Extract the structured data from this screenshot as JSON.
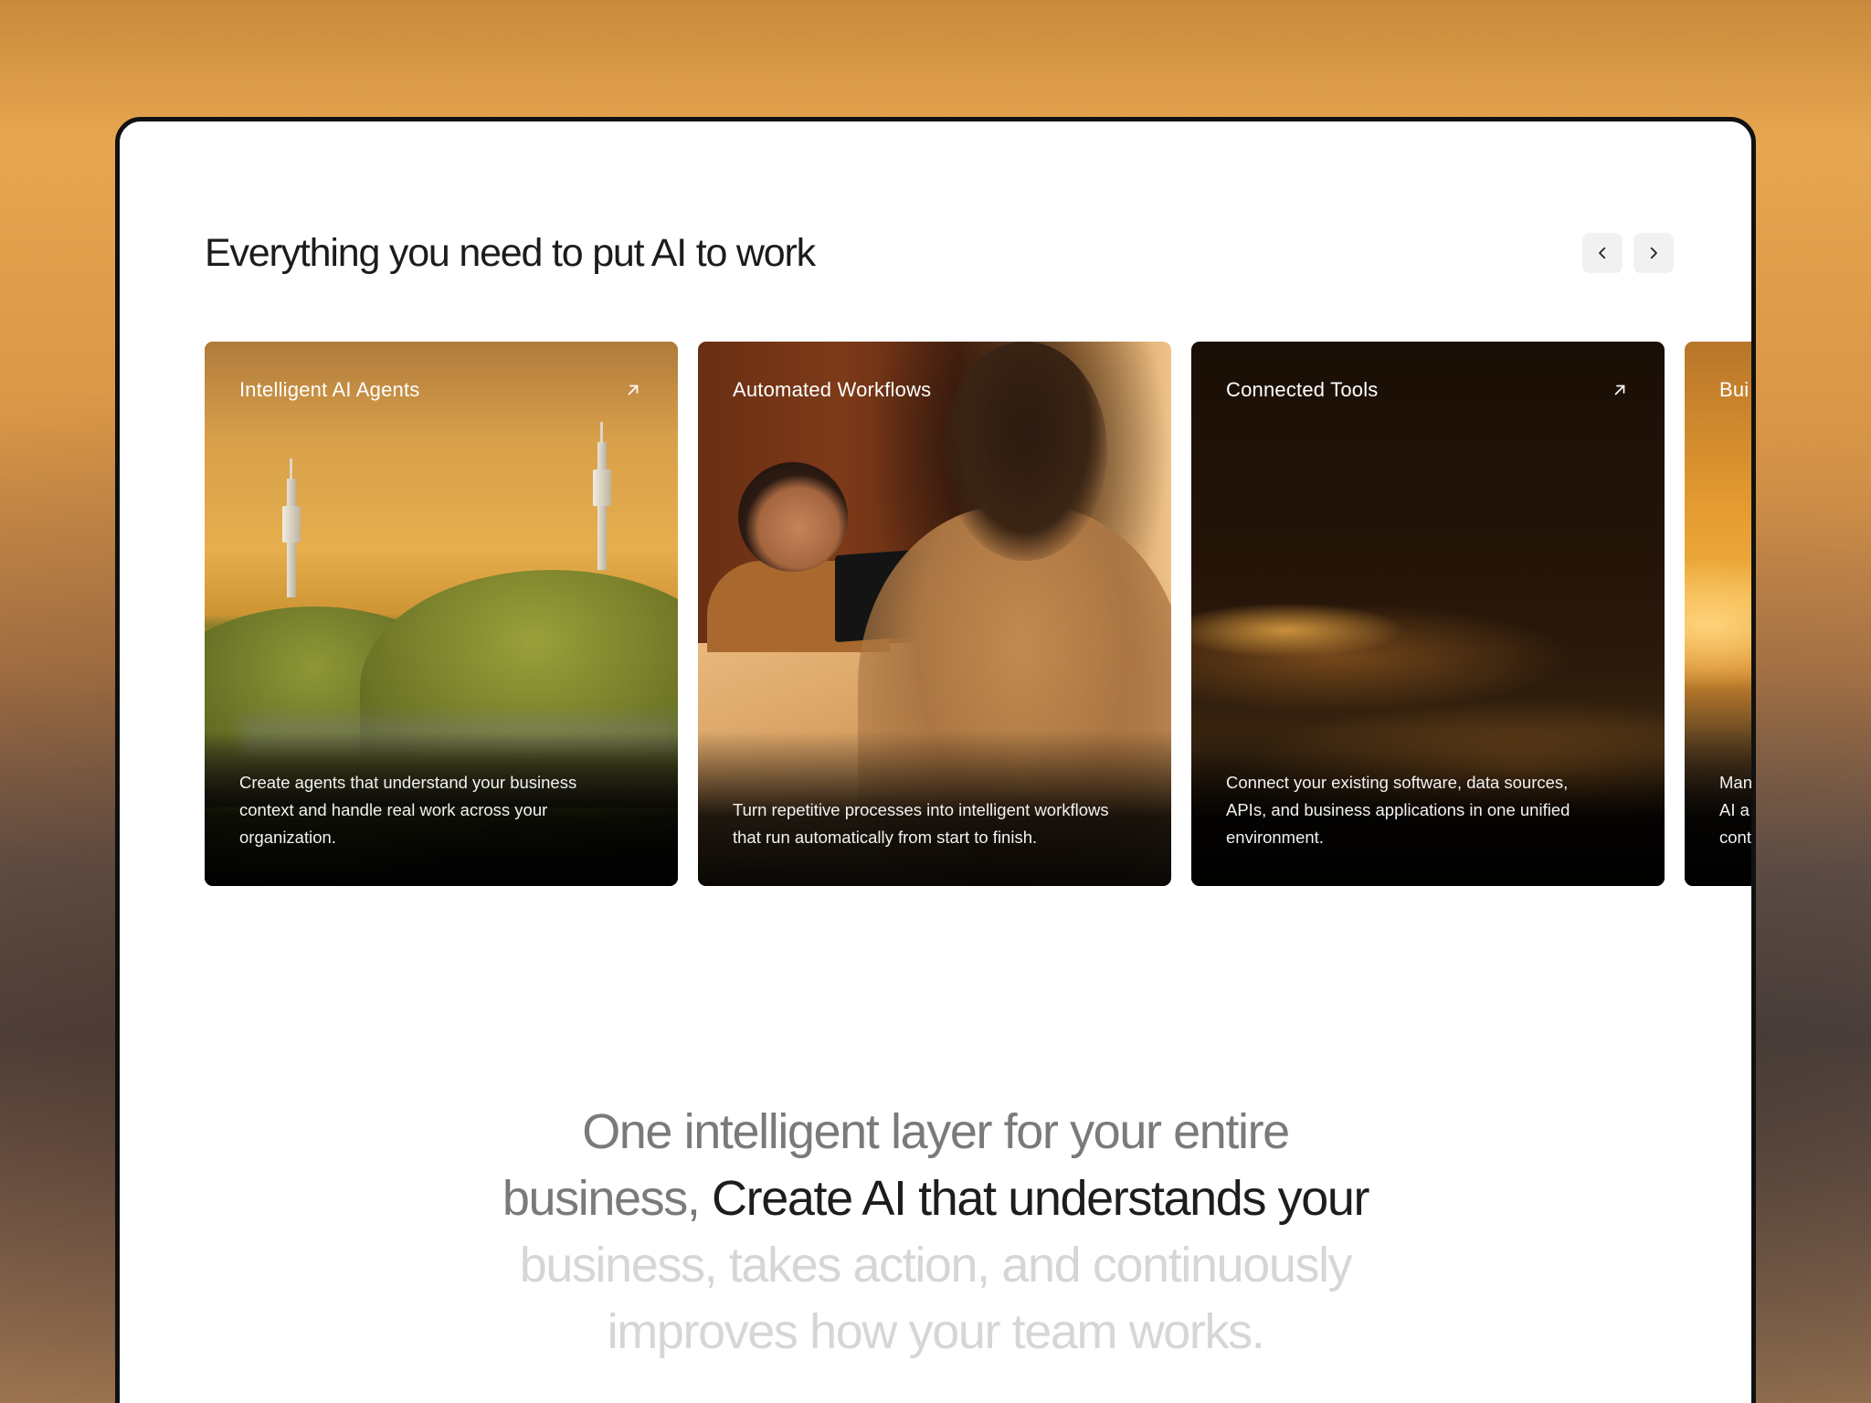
{
  "section": {
    "title": "Everything you need to put AI to work",
    "prev_icon": "chevron-left-icon",
    "next_icon": "chevron-right-icon"
  },
  "cards": [
    {
      "title": "Intelligent AI Agents",
      "description": "Create agents that understand your business context and handle real work across your organization.",
      "icon": "arrow-up-right-icon"
    },
    {
      "title": "Automated Workflows",
      "description": "Turn repetitive processes into intelligent workflows that run automatically from start to finish."
    },
    {
      "title": "Connected Tools",
      "description": "Connect your existing software, data sources, APIs, and business applications in one unified environment.",
      "icon": "arrow-up-right-icon"
    },
    {
      "title": "Bui",
      "description": "Man\nAI a\ncont"
    }
  ],
  "statement": {
    "line1": "One intelligent layer for your entire",
    "line2_grey": "business,",
    "line2_dark": "Create AI that understands your",
    "line3": "business, takes action, and continuously",
    "line4": "improves how your team works."
  },
  "colors": {
    "accent_dark": "#1d1d1d",
    "muted_text": "#7a7a7a",
    "faded_text": "#d6d6d6"
  }
}
